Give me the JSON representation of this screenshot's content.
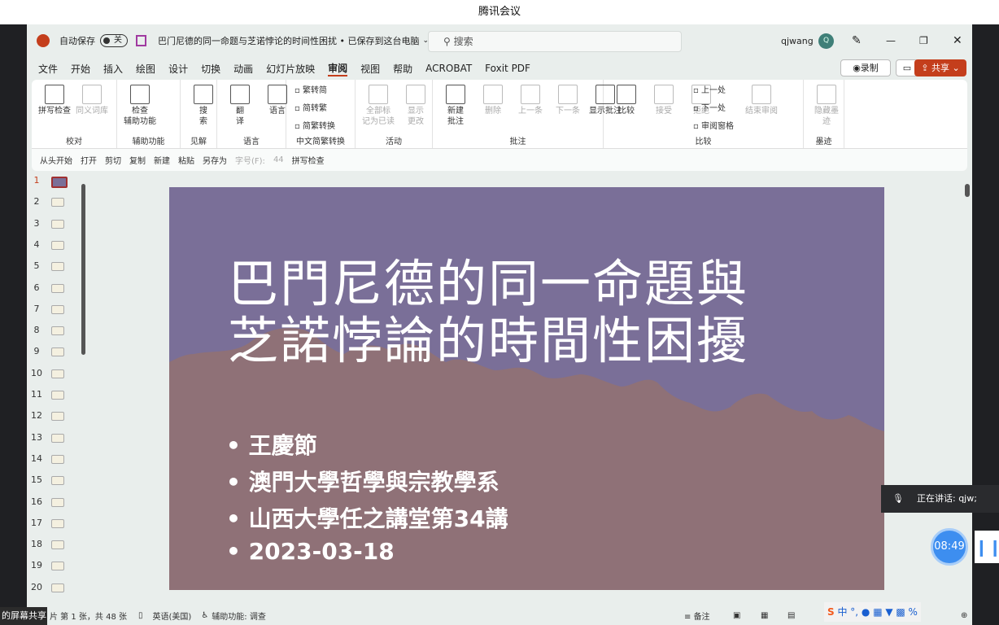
{
  "meeting": {
    "app_title": "腾讯会议",
    "speaking": "正在讲话: qjw;",
    "timer": "08:49",
    "share_label": "的屏幕共享"
  },
  "titlebar": {
    "autosave": "自动保存",
    "toggle": "关",
    "doc_title": "巴门尼德的同一命题与芝诺悖论的时间性困扰 • 已保存到这台电脑",
    "search": "搜索",
    "user": "qjwang",
    "avatar": "Q"
  },
  "menus": [
    "文件",
    "开始",
    "插入",
    "绘图",
    "设计",
    "切换",
    "动画",
    "幻灯片放映",
    "审阅",
    "视图",
    "帮助",
    "ACROBAT",
    "Foxit PDF"
  ],
  "active_menu": "审阅",
  "actions": {
    "record": "录制",
    "share": "共享"
  },
  "accent": "#c43e1c",
  "ribbon": {
    "groups": [
      {
        "label": "校对",
        "buttons": [
          "拼写检查",
          "同义词库"
        ]
      },
      {
        "label": "辅助功能",
        "buttons": [
          "检查\n辅助功能"
        ]
      },
      {
        "label": "见解",
        "buttons": [
          "搜\n索"
        ]
      },
      {
        "label": "语言",
        "buttons": [
          "翻\n译",
          "语言"
        ]
      },
      {
        "label": "中文简繁转换",
        "buttons": [
          "繁转简",
          "简转繁",
          "简繁转换"
        ]
      },
      {
        "label": "活动",
        "buttons": [
          "全部标\n记为已读",
          "显示\n更改"
        ]
      },
      {
        "label": "批注",
        "buttons": [
          "新建\n批注",
          "删除",
          "上一条",
          "下一条",
          "显示批注"
        ]
      },
      {
        "label": "比较",
        "buttons": [
          "比较",
          "接受",
          "拒绝",
          "上一处",
          "下一处",
          "审阅窗格",
          "结束审阅"
        ]
      },
      {
        "label": "墨迹",
        "buttons": [
          "隐藏墨\n迹"
        ]
      }
    ]
  },
  "qat": [
    "从头开始",
    "打开",
    "剪切",
    "复制",
    "新建",
    "粘贴",
    "另存为",
    "字号(F):",
    "44",
    "拼写检查"
  ],
  "thumbnails": [
    "1",
    "2",
    "3",
    "4",
    "5",
    "6",
    "7",
    "8",
    "9",
    "10",
    "11",
    "12",
    "13",
    "14",
    "15",
    "16",
    "17",
    "18",
    "19",
    "20"
  ],
  "slide": {
    "title_lines": [
      "巴門尼德的同一命題與",
      "芝諾悖論的時間性困擾"
    ],
    "bullets": [
      "王慶節",
      "澳門大學哲學與宗教學系",
      "山西大學任之講堂第34講",
      "2023-03-18"
    ]
  },
  "status": {
    "slide_info": "片 第 1 张，共 48 张",
    "language": "英语(美国)",
    "accessibility": "辅助功能: 调查",
    "notes": "备注"
  }
}
